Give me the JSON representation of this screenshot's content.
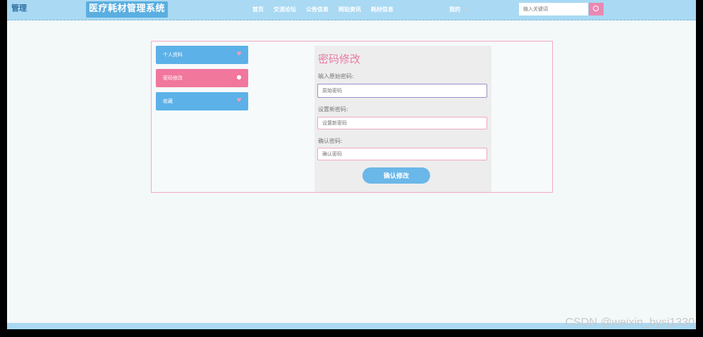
{
  "header": {
    "logo_text": "管理",
    "site_title": "医疗耗材管理系统",
    "nav": [
      "首页",
      "交流论坛",
      "公告信息",
      "网站资讯",
      "耗材信息"
    ],
    "mine": "我的",
    "search_placeholder": "输入关键词"
  },
  "sidebar": {
    "items": [
      {
        "label": "个人资料",
        "icon": "heart-icon"
      },
      {
        "label": "密码修改",
        "icon": "user-icon"
      },
      {
        "label": "收藏",
        "icon": "heart-icon"
      }
    ]
  },
  "form": {
    "title": "密码修改",
    "old_label": "输入原始密码:",
    "old_placeholder": "原始密码",
    "new_label": "设置新密码:",
    "new_placeholder": "设置新密码",
    "confirm_label": "确认密码:",
    "confirm_placeholder": "确认密码",
    "submit": "确认修改"
  },
  "watermark": "CSDN @weixin_bysj1330",
  "colors": {
    "topbar": "#a9d9f3",
    "accent_blue": "#5cb1e8",
    "accent_pink": "#f1779d"
  }
}
